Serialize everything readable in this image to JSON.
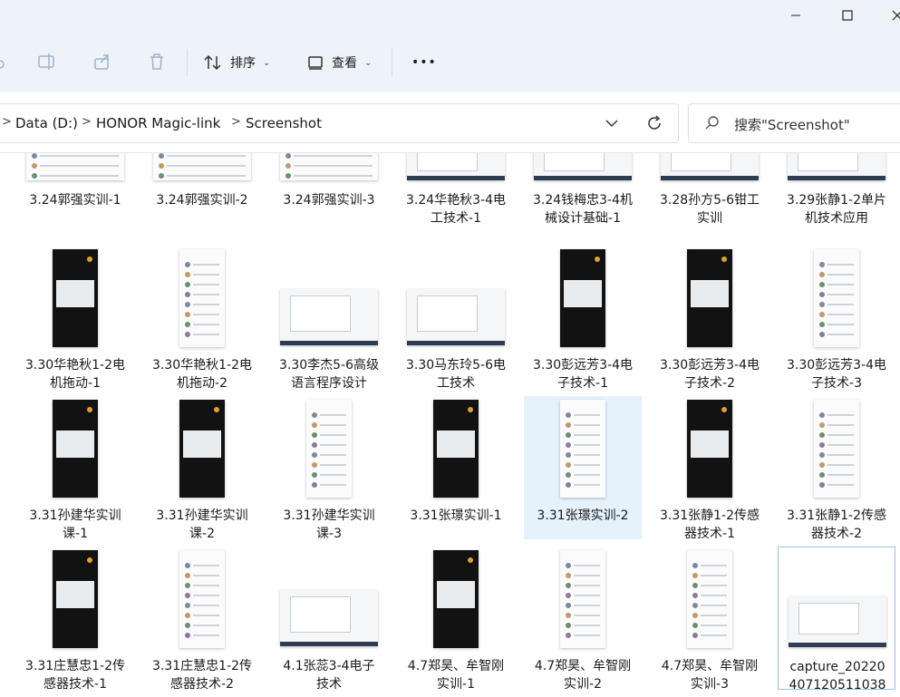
{
  "toolbar": {
    "sort_label": "排序",
    "view_label": "查看",
    "more_label": "•••"
  },
  "address": {
    "crumbs": [
      "Data (D:)",
      "HONOR Magic-link",
      "Screenshot"
    ],
    "separator": ">"
  },
  "search": {
    "placeholder": "搜索\"Screenshot\""
  },
  "files": [
    {
      "line1": "3.24郭强实训-1",
      "line2": ""
    },
    {
      "line1": "3.24郭强实训-2",
      "line2": ""
    },
    {
      "line1": "3.24郭强实训-3",
      "line2": ""
    },
    {
      "line1": "3.24华艳秋3-4电",
      "line2": "工技术-1"
    },
    {
      "line1": "3.24钱梅忠3-4机",
      "line2": "械设计基础-1"
    },
    {
      "line1": "3.28孙方5-6钳工",
      "line2": "实训"
    },
    {
      "line1": "3.29张静1-2单片",
      "line2": "机技术应用"
    },
    {
      "line1": "3.30华艳秋1-2电",
      "line2": "机拖动-1"
    },
    {
      "line1": "3.30华艳秋1-2电",
      "line2": "机拖动-2"
    },
    {
      "line1": "3.30李杰5-6高级",
      "line2": "语言程序设计"
    },
    {
      "line1": "3.30马东玲5-6电",
      "line2": "工技术"
    },
    {
      "line1": "3.30彭远芳3-4电",
      "line2": "子技术-1"
    },
    {
      "line1": "3.30彭远芳3-4电",
      "line2": "子技术-2"
    },
    {
      "line1": "3.30彭远芳3-4电",
      "line2": "子技术-3"
    },
    {
      "line1": "3.31孙建华实训",
      "line2": "课-1"
    },
    {
      "line1": "3.31孙建华实训",
      "line2": "课-2"
    },
    {
      "line1": "3.31孙建华实训",
      "line2": "课-3"
    },
    {
      "line1": "3.31张璟实训-1",
      "line2": ""
    },
    {
      "line1": "3.31张璟实训-2",
      "line2": ""
    },
    {
      "line1": "3.31张静1-2传感",
      "line2": "器技术-1"
    },
    {
      "line1": "3.31张静1-2传感",
      "line2": "器技术-2"
    },
    {
      "line1": "3.31庄慧忠1-2传",
      "line2": "感器技术-1"
    },
    {
      "line1": "3.31庄慧忠1-2传",
      "line2": "感器技术-2"
    },
    {
      "line1": "4.1张蕊3-4电子",
      "line2": "技术"
    },
    {
      "line1": "4.7郑昊、牟智刚",
      "line2": "实训-1"
    },
    {
      "line1": "4.7郑昊、牟智刚",
      "line2": "实训-2"
    },
    {
      "line1": "4.7郑昊、牟智刚",
      "line2": "实训-3"
    },
    {
      "line1": "capture_20220",
      "line2": "407120511038"
    }
  ]
}
